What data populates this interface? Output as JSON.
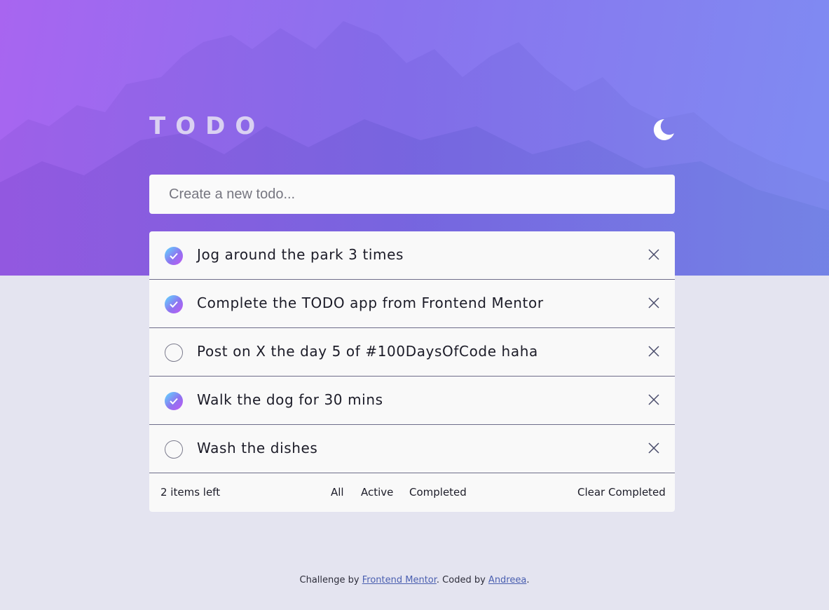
{
  "header": {
    "title": "TODO",
    "theme_icon": "moon-icon"
  },
  "new_todo": {
    "placeholder": "Create a new todo...",
    "value": ""
  },
  "todos": [
    {
      "text": "Jog around the park 3 times",
      "completed": true
    },
    {
      "text": "Complete the TODO app from Frontend Mentor",
      "completed": true
    },
    {
      "text": "Post on X the day 5 of #100DaysOfCode haha",
      "completed": false
    },
    {
      "text": "Walk the dog for 30 mins",
      "completed": true
    },
    {
      "text": "Wash the dishes",
      "completed": false
    }
  ],
  "footer": {
    "items_left": "2 items left",
    "filters": [
      "All",
      "Active",
      "Completed"
    ],
    "clear_label": "Clear Completed"
  },
  "attribution": {
    "prefix": "Challenge by ",
    "frontend_mentor": "Frontend Mentor",
    "middle": ". Coded by ",
    "author": "Andreea",
    "suffix": "."
  },
  "colors": {
    "check_gradient_start": "#5ddcff",
    "check_gradient_end": "#c058f3",
    "background": "#e4e4f0",
    "card": "#f9f9f9"
  }
}
